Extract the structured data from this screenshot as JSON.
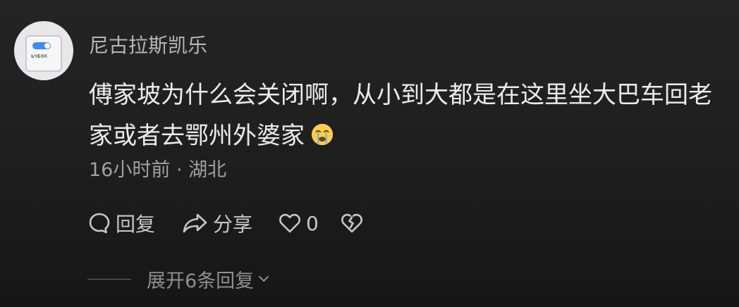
{
  "comment": {
    "avatar": {
      "icon": "toggle-card-avatar",
      "tag_text": "ЬЧБ6К"
    },
    "username": "尼古拉斯凯乐",
    "text_lines": [
      "傅家坡为什么会关闭啊，从小到大都是在这里坐大巴车回老",
      "家或者去鄂州外婆家"
    ],
    "emoji": "crying-face-emoji",
    "time": "16小时前",
    "separator": "·",
    "location": "湖北",
    "actions": {
      "reply_label": "回复",
      "share_label": "分享",
      "like_count": "0"
    },
    "replies": {
      "expand_label": "展开6条回复"
    }
  },
  "colors": {
    "background": "#1f1f1f",
    "text_primary": "#ececec",
    "text_secondary": "#a0a0a0",
    "icon": "#c8c8c8"
  }
}
